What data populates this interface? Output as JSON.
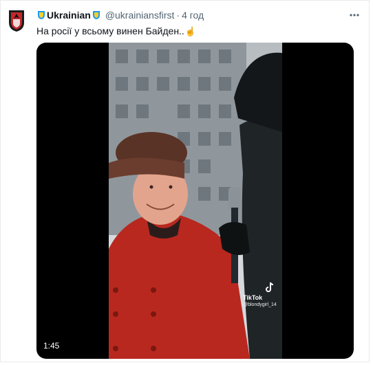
{
  "tweet": {
    "display_name": "Ukrainian",
    "handle": "@ukrainiansfirst",
    "separator": "·",
    "time": "4 год",
    "text": "На росії у всьому винен Байден..",
    "emoji": "☝",
    "avatar_icon": "red-black-shield-logo",
    "name_badge_icon": "ukraine-shield-icon",
    "more_icon": "ellipsis-icon"
  },
  "video": {
    "duration": "1:45",
    "watermark_brand": "TikTok",
    "watermark_user": "@blondygirl_14"
  },
  "colors": {
    "text_primary": "#0f1419",
    "text_secondary": "#536471",
    "badge_blue": "#1d9bf0",
    "badge_yellow": "#f7d02c",
    "coat_red": "#b8281f"
  }
}
